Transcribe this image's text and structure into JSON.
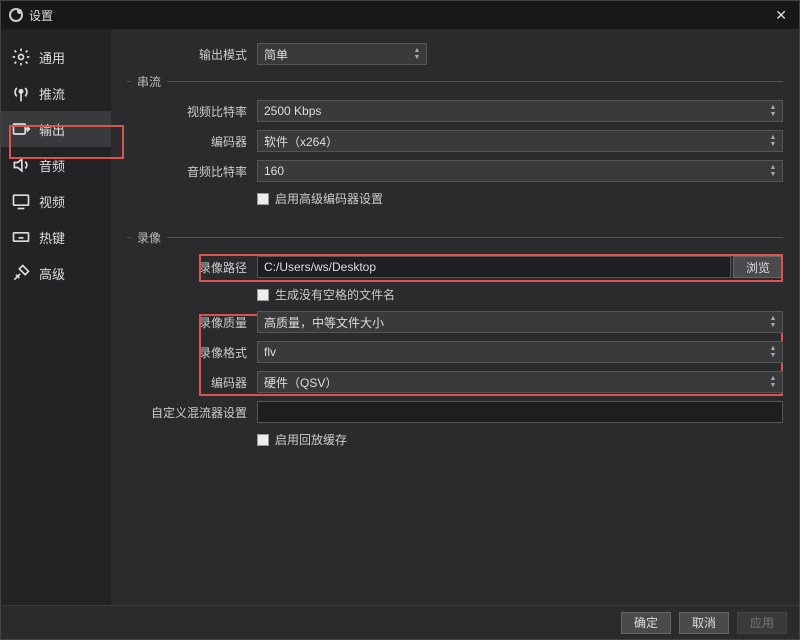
{
  "titlebar": {
    "title": "设置"
  },
  "sidebar": {
    "items": [
      {
        "label": "通用"
      },
      {
        "label": "推流"
      },
      {
        "label": "输出"
      },
      {
        "label": "音频"
      },
      {
        "label": "视频"
      },
      {
        "label": "热键"
      },
      {
        "label": "高级"
      }
    ]
  },
  "labels": {
    "output_mode": "输出模式",
    "streaming": "串流",
    "video_bitrate": "视频比特率",
    "encoder": "编码器",
    "audio_bitrate": "音频比特率",
    "adv_encoder": "启用高级编码器设置",
    "recording": "录像",
    "rec_path": "录像路径",
    "browse": "浏览",
    "no_space_filename": "生成没有空格的文件名",
    "rec_quality": "录像质量",
    "rec_format": "录像格式",
    "rec_encoder": "编码器",
    "custom_muxer": "自定义混流器设置",
    "replay_buffer": "启用回放缓存"
  },
  "values": {
    "output_mode": "简单",
    "video_bitrate": "2500 Kbps",
    "stream_encoder": "软件（x264）",
    "audio_bitrate": "160",
    "rec_path": "C:/Users/ws/Desktop",
    "rec_quality": "高质量，中等文件大小",
    "rec_format": "flv",
    "rec_encoder": "硬件（QSV）"
  },
  "footer": {
    "ok": "确定",
    "cancel": "取消",
    "apply": "应用"
  }
}
